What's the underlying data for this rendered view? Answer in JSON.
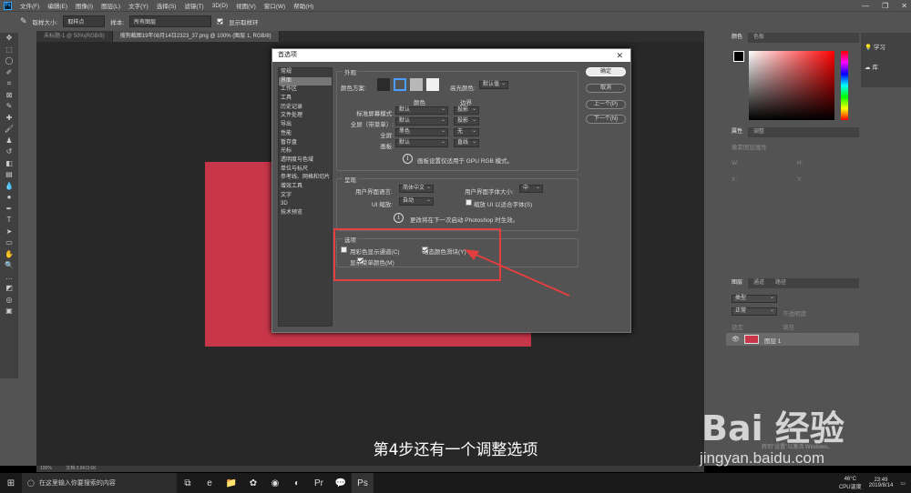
{
  "menu": {
    "items": [
      "文件(F)",
      "编辑(E)",
      "图像(I)",
      "图层(L)",
      "文字(Y)",
      "选择(S)",
      "滤镜(T)",
      "3D(D)",
      "视图(V)",
      "窗口(W)",
      "帮助(H)"
    ]
  },
  "options": {
    "size_label": "取样大小:",
    "size_value": "取样点",
    "sample_label": "样本:",
    "sample_value": "所有图层",
    "ring_label": "显示取样环"
  },
  "doc_tabs": [
    "未标题-1 @ 50%(RGB/8)",
    "搜狗截图19年08月14日2323_37.png @ 100% (图层 1, RGB/8)"
  ],
  "status": {
    "zoom": "100%",
    "doc": "文档:3.6K/3.6K"
  },
  "dialog": {
    "title": "首选项",
    "categories": [
      "常规",
      "界面",
      "工作区",
      "工具",
      "历史记录",
      "文件处理",
      "导出",
      "性能",
      "暂存盘",
      "光标",
      "透明度与色域",
      "单位与标尺",
      "参考线、网格和切片",
      "增效工具",
      "文字",
      "3D",
      "技术预览"
    ],
    "selected_category": "界面",
    "appearance": {
      "group": "外观",
      "color_scheme_label": "颜色方案:",
      "highlight_label": "高光颜色:",
      "highlight_value": "默认值",
      "col_color": "颜色",
      "col_border": "边界",
      "rows": [
        {
          "label": "标准屏幕模式:",
          "color": "默认",
          "border": "投影"
        },
        {
          "label": "全屏（带菜单）:",
          "color": "默认",
          "border": "投影"
        },
        {
          "label": "全屏:",
          "color": "黑色",
          "border": "无"
        },
        {
          "label": "画板:",
          "color": "默认",
          "border": "直线"
        }
      ],
      "note": "画板设置仅适用于 GPU RGB 模式。"
    },
    "text": {
      "group": "呈现",
      "ui_lang_label": "用户界面语言:",
      "ui_lang_value": "简体中文",
      "ui_font_label": "用户界面字体大小:",
      "ui_font_value": "中",
      "ui_scale_label": "UI 缩放:",
      "ui_scale_value": "自动",
      "scale_font_label": "缩放 UI 以适合字体(S)",
      "note": "更改将在下一次启动 Photoshop 时生效。"
    },
    "options": {
      "group": "选项",
      "show_channels": "用彩色显示通道(C)",
      "dynamic_sliders": "动态颜色滑块(Y)",
      "menu_colors": "显示菜单颜色(M)"
    },
    "buttons": {
      "ok": "确定",
      "cancel": "取消",
      "prev": "上一个(P)",
      "next": "下一个(N)"
    }
  },
  "right": {
    "color_tabs": [
      "颜色",
      "色板"
    ],
    "learn": "学习",
    "library": "库",
    "props_tabs": [
      "属性",
      "调整"
    ],
    "props_title": "像素图层属性",
    "props_w": "W:",
    "props_h": "H:",
    "props_x": "X:",
    "props_y": "Y:",
    "layers_tabs": [
      "图层",
      "通道",
      "路径"
    ],
    "layers_kind": "类型",
    "layers_mode": "正常",
    "opacity_label": "不透明度:",
    "lock_label": "锁定:",
    "fill_label": "填充:",
    "layer_name": "图层 1"
  },
  "overlay": {
    "subtitle": "第4步还有一个调整选项",
    "watermark_brand": "Bai 经验",
    "watermark_url": "jingyan.baidu.com",
    "activate": "转到\"设置\"以激活 Windows。"
  },
  "taskbar": {
    "search": "在这里输入你要搜索的内容",
    "temp": "46°C",
    "cpu": "CPU温度",
    "time": "23:49",
    "date": "2019/8/14"
  },
  "colors": {
    "highlight_box": "#e24040",
    "doc_fill": "#c8364a",
    "picker_red": "#ff0000"
  }
}
